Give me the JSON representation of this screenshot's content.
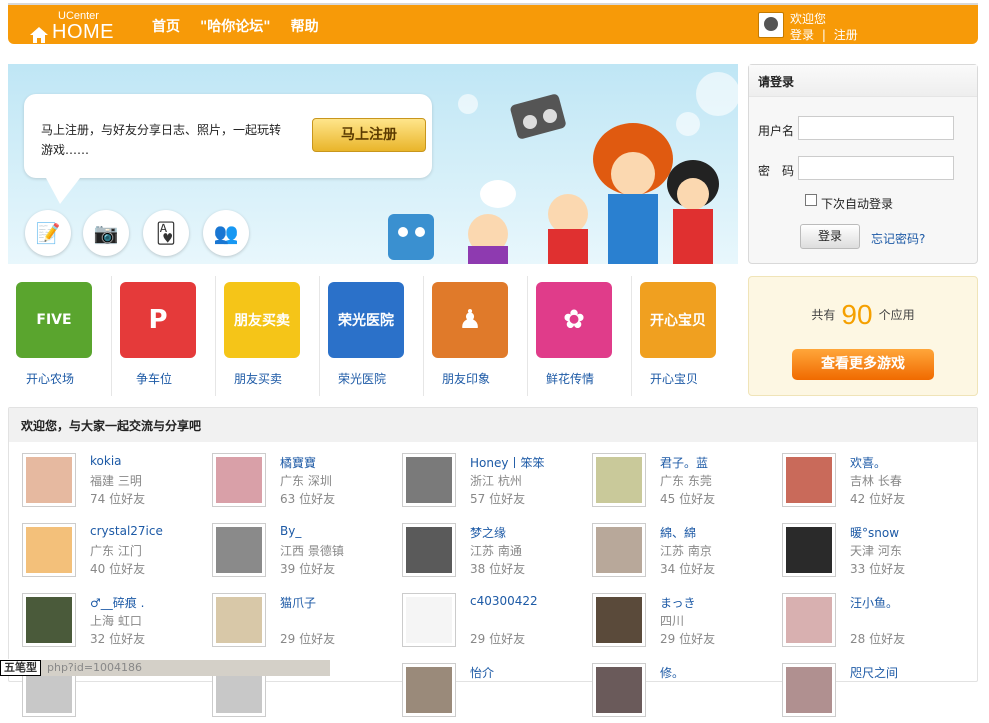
{
  "header": {
    "logo_small": "UCenter",
    "logo_big": "HOME",
    "nav": [
      "首页",
      "\"哈你论坛\"",
      "帮助"
    ],
    "welcome": "欢迎您",
    "login_link": "登录",
    "sep": "|",
    "register_link": "注册"
  },
  "banner": {
    "text": "马上注册，与好友分享日志、照片，一起玩转游戏……",
    "register_button": "马上注册"
  },
  "login_box": {
    "title": "请登录",
    "username_label": "用户名",
    "password_label": "密　码",
    "remember": "下次自动登录",
    "submit": "登录",
    "forgot": "忘记密码?"
  },
  "apps": [
    {
      "label": "开心农场",
      "color": "#5aa52e",
      "icon_text": "FIVE"
    },
    {
      "label": "争车位",
      "color": "#e53a3a",
      "icon_text": "P"
    },
    {
      "label": "朋友买卖",
      "color": "#f5c518",
      "icon_text": "朋友买卖"
    },
    {
      "label": "荣光医院",
      "color": "#2b71c9",
      "icon_text": "荣光医院"
    },
    {
      "label": "朋友印象",
      "color": "#e07a2a",
      "icon_text": "♟"
    },
    {
      "label": "鲜花传情",
      "color": "#e03c8a",
      "icon_text": "✿"
    },
    {
      "label": "开心宝贝",
      "color": "#f0a020",
      "icon_text": "开心宝贝"
    }
  ],
  "app_count": {
    "prefix": "共有",
    "number": "90",
    "suffix": "个应用",
    "more_button": "查看更多游戏"
  },
  "friends": {
    "title": "欢迎您，与大家一起交流与分享吧",
    "list": [
      {
        "name": "kokia",
        "location": "福建 三明",
        "count": "74 位好友",
        "color": "#e6b9a0"
      },
      {
        "name": "橘寶寶",
        "location": "广东 深圳",
        "count": "63 位好友",
        "color": "#d9a0a8"
      },
      {
        "name": "Honey丨笨笨",
        "location": "浙江 杭州",
        "count": "57 位好友",
        "color": "#7a7a7a"
      },
      {
        "name": "君子。蓝",
        "location": "广东 东莞",
        "count": "45 位好友",
        "color": "#c9c99a"
      },
      {
        "name": "欢喜。",
        "location": "吉林 长春",
        "count": "42 位好友",
        "color": "#c96a5a"
      },
      {
        "name": "crystal27ice",
        "location": "广东 江门",
        "count": "40 位好友",
        "color": "#f3c07a"
      },
      {
        "name": "By_",
        "location": "江西 景德镇",
        "count": "39 位好友",
        "color": "#8a8a8a"
      },
      {
        "name": "梦之缘",
        "location": "江苏 南通",
        "count": "38 位好友",
        "color": "#5a5a5a"
      },
      {
        "name": "綿、綿",
        "location": "江苏 南京",
        "count": "34 位好友",
        "color": "#b8a89a"
      },
      {
        "name": "暖°snow",
        "location": "天津 河东",
        "count": "33 位好友",
        "color": "#2a2a2a"
      },
      {
        "name": "♂__碎痕 .",
        "location": "上海 虹口",
        "count": "32 位好友",
        "color": "#4a5a3a"
      },
      {
        "name": "猫爪子",
        "location": "",
        "count": "29 位好友",
        "color": "#d8c8a8"
      },
      {
        "name": "c40300422",
        "location": "",
        "count": "29 位好友",
        "color": "#f5f5f5"
      },
      {
        "name": "まっき",
        "location": "四川",
        "count": "29 位好友",
        "color": "#5a4a3a"
      },
      {
        "name": "汪小鱼。",
        "location": "",
        "count": "28 位好友",
        "color": "#d8b0b0"
      },
      {
        "name": "",
        "location": "",
        "count": "",
        "color": "#c8c8c8"
      },
      {
        "name": "",
        "location": "",
        "count": "",
        "color": "#c8c8c8"
      },
      {
        "name": "怡介",
        "location": "",
        "count": "",
        "color": "#9a8a7a"
      },
      {
        "name": "修。",
        "location": "",
        "count": "",
        "color": "#6a5a5a"
      },
      {
        "name": "咫尺之间",
        "location": "",
        "count": "",
        "color": "#b09090"
      }
    ]
  },
  "taskbar": {
    "ime": "五笔型",
    "status": "php?id=1004186"
  }
}
